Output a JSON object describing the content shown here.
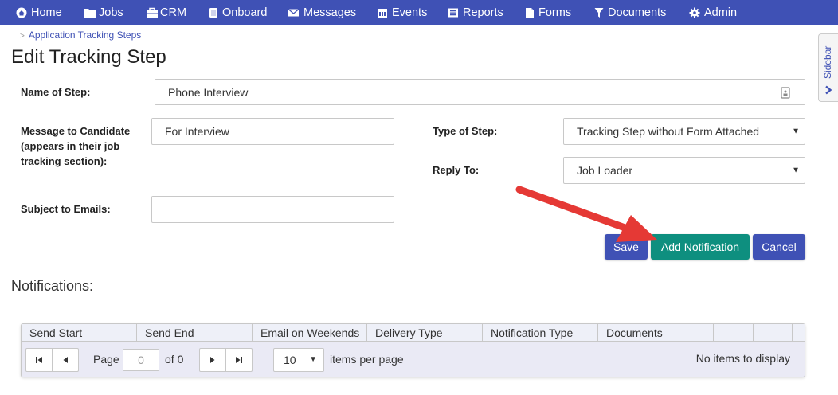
{
  "nav": {
    "items": [
      {
        "label": "Home",
        "icon": "home-icon"
      },
      {
        "label": "Jobs",
        "icon": "folder-icon"
      },
      {
        "label": "CRM",
        "icon": "briefcase-icon"
      },
      {
        "label": "Onboard",
        "icon": "clipboard-icon"
      },
      {
        "label": "Messages",
        "icon": "envelope-icon"
      },
      {
        "label": "Events",
        "icon": "calendar-icon"
      },
      {
        "label": "Reports",
        "icon": "report-icon"
      },
      {
        "label": "Forms",
        "icon": "file-icon"
      },
      {
        "label": "Documents",
        "icon": "filter-icon"
      },
      {
        "label": "Admin",
        "icon": "gear-icon"
      }
    ],
    "bg_color": "#3f51b5"
  },
  "breadcrumb": {
    "separator": ">",
    "label": "Application Tracking Steps"
  },
  "page_title": "Edit Tracking Step",
  "sidebar_tab": {
    "label": "Sidebar"
  },
  "form": {
    "name_of_step_label": "Name of Step:",
    "name_of_step_value": "Phone Interview",
    "message_label": "Message to Candidate (appears in their job tracking section):",
    "message_value": "For Interview",
    "subject_label": "Subject to Emails:",
    "subject_value": "",
    "type_label": "Type of Step:",
    "type_value": "Tracking Step without Form Attached",
    "reply_label": "Reply To:",
    "reply_value": "Job Loader"
  },
  "buttons": {
    "save": "Save",
    "add_notification": "Add Notification",
    "cancel": "Cancel"
  },
  "notifications": {
    "title": "Notifications:",
    "columns": [
      "Send Start",
      "Send End",
      "Email on Weekends",
      "Delivery Type",
      "Notification Type",
      "Documents",
      "",
      ""
    ],
    "pager": {
      "page_label": "Page",
      "page_value": "0",
      "of_label": "of 0",
      "per_page_value": "10",
      "per_page_label": "items per page",
      "empty_message": "No items to display"
    }
  },
  "colors": {
    "primary": "#3f51b5",
    "success": "#0e8f7f",
    "annotation_arrow": "#e53935"
  }
}
